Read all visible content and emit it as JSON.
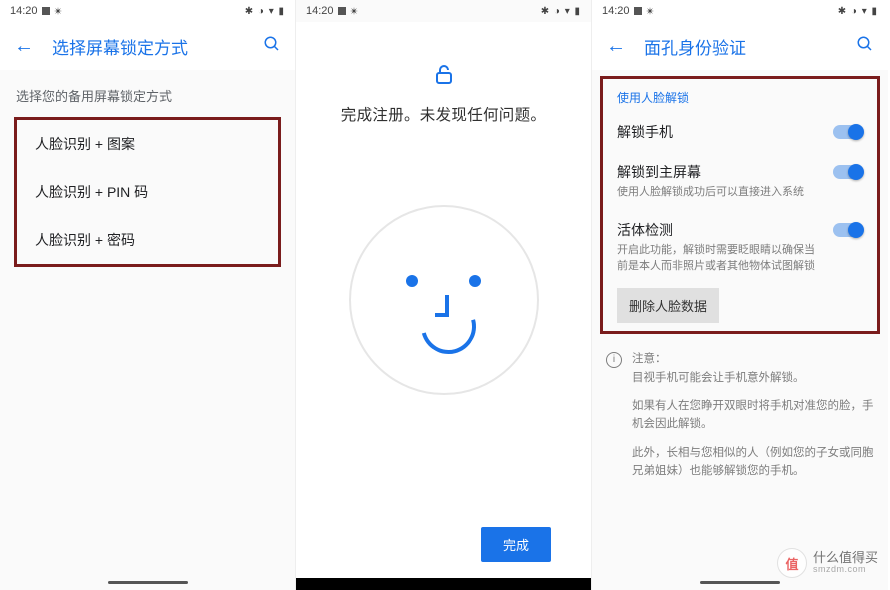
{
  "statusbar": {
    "time": "14:20",
    "icons_right": "✱ ◑ ▾ ▮"
  },
  "screen1": {
    "title": "选择屏幕锁定方式",
    "subtitle": "选择您的备用屏幕锁定方式",
    "options": [
      {
        "label": "人脸识别 + 图案"
      },
      {
        "label": "人脸识别 + PIN 码"
      },
      {
        "label": "人脸识别 + 密码"
      }
    ]
  },
  "screen2": {
    "message": "完成注册。未发现任何问题。",
    "done_label": "完成"
  },
  "screen3": {
    "title": "面孔身份验证",
    "section_head": "使用人脸解锁",
    "items": [
      {
        "title": "解锁手机",
        "sub": ""
      },
      {
        "title": "解锁到主屏幕",
        "sub": "使用人脸解锁成功后可以直接进入系统"
      },
      {
        "title": "活体检测",
        "sub": "开启此功能，解锁时需要眨眼睛以确保当前是本人而非照片或者其他物体试图解锁"
      }
    ],
    "delete_label": "删除人脸数据",
    "note_title": "注意：",
    "note_p1": "目视手机可能会让手机意外解锁。",
    "note_p2": "如果有人在您睁开双眼时将手机对准您的脸，手机会因此解锁。",
    "note_p3": "此外，长相与您相似的人（例如您的子女或同胞兄弟姐妹）也能够解锁您的手机。"
  },
  "watermark": {
    "char": "值",
    "text": "什么值得买",
    "en": "smzdm.com"
  }
}
